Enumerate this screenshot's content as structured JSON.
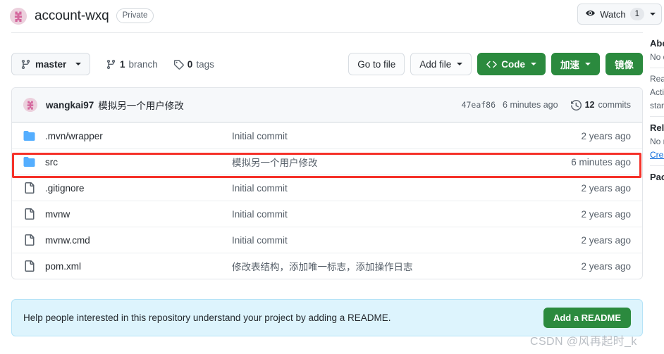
{
  "header": {
    "repo_name": "account-wxq",
    "visibility_badge": "Private",
    "avatar_icon": "repo-owner-avatar",
    "watch": {
      "label": "Watch",
      "count": "1",
      "icon": "eye-icon"
    }
  },
  "toolbar": {
    "branch": {
      "label": "master",
      "icon": "branch-icon"
    },
    "branches": {
      "count": "1",
      "label": "branch",
      "icon": "branch-icon"
    },
    "tags": {
      "count": "0",
      "label": "tags",
      "icon": "tag-icon"
    },
    "go_to_file": "Go to file",
    "add_file": "Add file",
    "code": "Code",
    "code_icon": "code-brackets-icon",
    "accelerate": "加速",
    "mirror": "镜像"
  },
  "commit_bar": {
    "avatar_icon": "commit-author-avatar",
    "author": "wangkai97",
    "message": "模拟另一个用户修改",
    "sha": "47eaf86",
    "time": "6 minutes ago",
    "commits_count": "12",
    "commits_label": "commits",
    "history_icon": "history-clock-icon"
  },
  "files": [
    {
      "icon": "folder-icon",
      "type": "folder",
      "name": ".mvn/wrapper",
      "message": "Initial commit",
      "time": "2 years ago",
      "highlighted": false
    },
    {
      "icon": "folder-icon",
      "type": "folder",
      "name": "src",
      "message": "模拟另一个用户修改",
      "time": "6 minutes ago",
      "highlighted": true
    },
    {
      "icon": "file-icon",
      "type": "file",
      "name": ".gitignore",
      "message": "Initial commit",
      "time": "2 years ago",
      "highlighted": false
    },
    {
      "icon": "file-icon",
      "type": "file",
      "name": "mvnw",
      "message": "Initial commit",
      "time": "2 years ago",
      "highlighted": false
    },
    {
      "icon": "file-icon",
      "type": "file",
      "name": "mvnw.cmd",
      "message": "Initial commit",
      "time": "2 years ago",
      "highlighted": false
    },
    {
      "icon": "file-icon",
      "type": "file",
      "name": "pom.xml",
      "message": "修改表结构，添加唯一标志，添加操作日志",
      "time": "2 years ago",
      "highlighted": false
    }
  ],
  "readme_banner": {
    "text": "Help people interested in this repository understand your project by adding a README.",
    "button": "Add a README"
  },
  "watermark": "CSDN @风再起时_k",
  "colors": {
    "green_button": "#2b8a3e",
    "annotation_red": "#f5322a",
    "banner_blue_bg": "#ddf4fd",
    "banner_blue_border": "#b6e3f7",
    "folder_blue": "#54aeff",
    "avatar_pink": "#d4669d",
    "link_blue": "#0969da"
  }
}
